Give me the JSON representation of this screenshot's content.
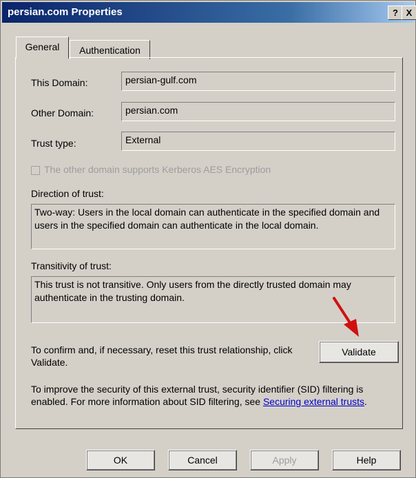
{
  "window": {
    "title": "persian.com Properties",
    "help_btn": "?",
    "close_btn": "X"
  },
  "tabs": [
    {
      "label": "General",
      "active": true
    },
    {
      "label": "Authentication",
      "active": false
    }
  ],
  "general": {
    "this_domain_label": "This Domain:",
    "this_domain_value": "persian-gulf.com",
    "other_domain_label": "Other Domain:",
    "other_domain_value": "persian.com",
    "trust_type_label": "Trust type:",
    "trust_type_value": "External",
    "kerberos_checkbox_label": "The other domain supports Kerberos AES Encryption",
    "kerberos_checked": false,
    "direction_label": "Direction of trust:",
    "direction_text": "Two-way: Users in the local domain can authenticate in the specified domain and users in the specified domain can authenticate in the local domain.",
    "transitivity_label": "Transitivity of trust:",
    "transitivity_text": "This trust is not transitive. Only users from the directly trusted domain may authenticate in the trusting domain.",
    "validate_text": "To confirm and, if necessary, reset this trust relationship, click Validate.",
    "validate_button": "Validate",
    "sid_text_before": "To improve the security of this external trust, security identifier (SID) filtering is enabled. For more information about SID filtering, see ",
    "sid_link": "Securing external trusts",
    "sid_text_after": "."
  },
  "footer": {
    "ok": "OK",
    "cancel": "Cancel",
    "apply": "Apply",
    "help": "Help"
  },
  "colors": {
    "annotation_arrow": "#d01010"
  }
}
